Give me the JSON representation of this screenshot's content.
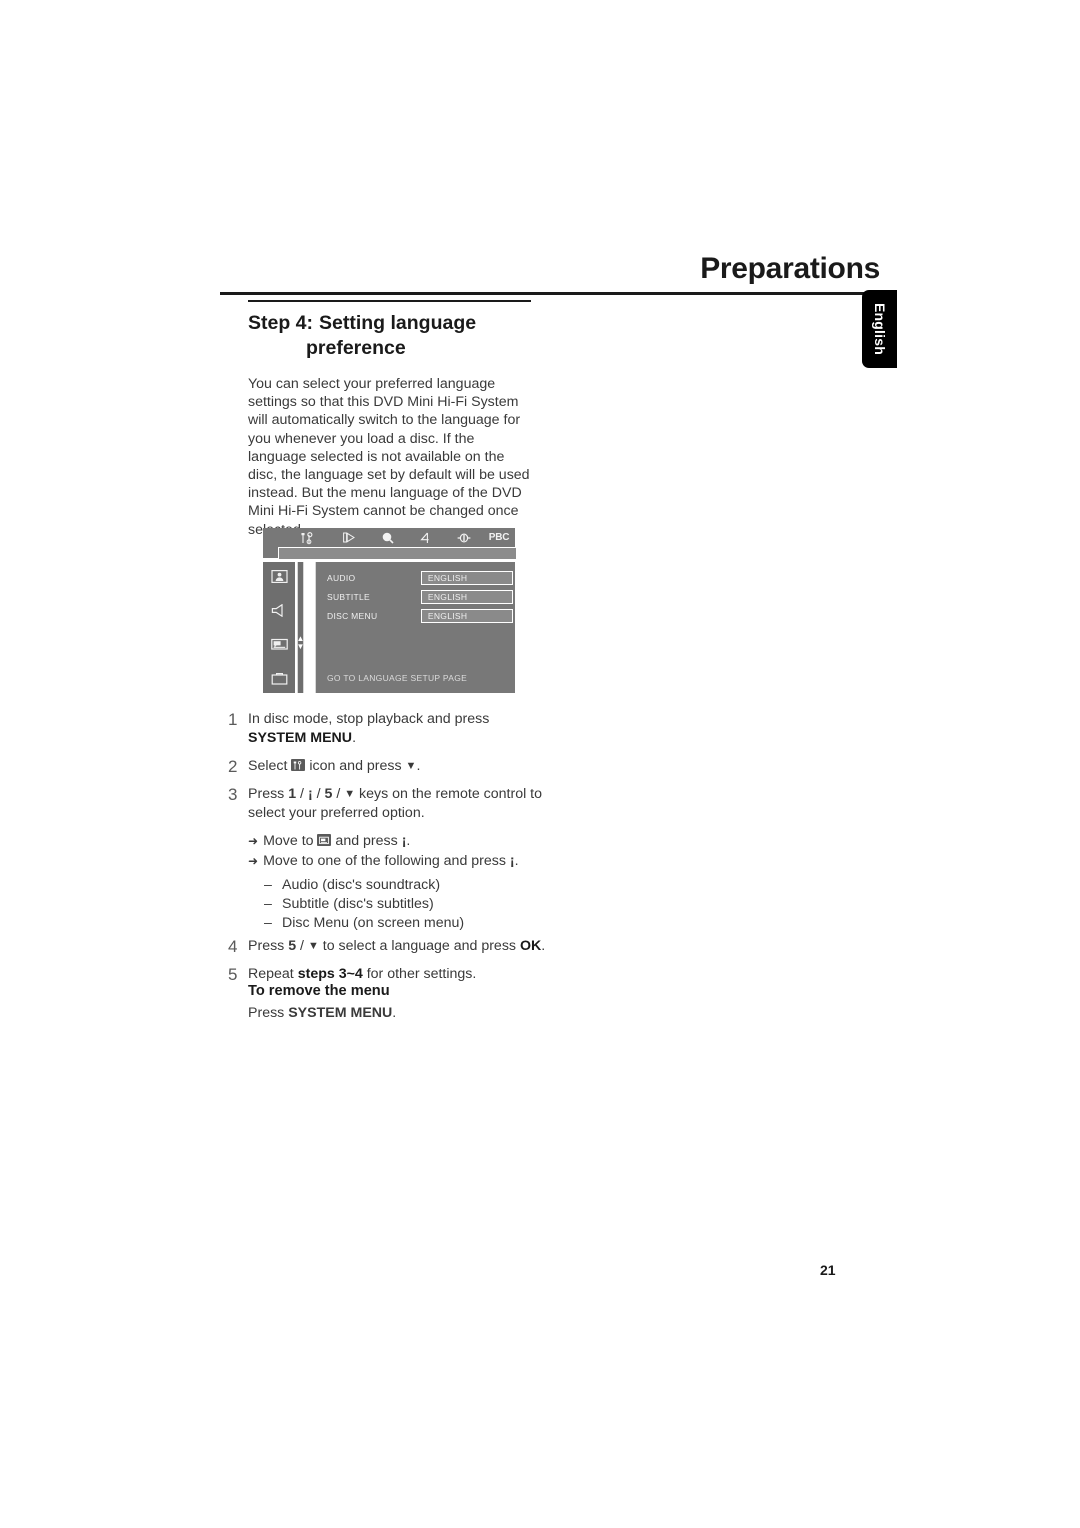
{
  "page": {
    "title": "Preparations",
    "number": "21",
    "language_tab": "English"
  },
  "section": {
    "step_label": "Step 4:",
    "title_line1": "Setting language",
    "title_line2": "preference",
    "intro": "You can select your preferred language settings so that this DVD Mini Hi-Fi System will automatically switch to the language for you whenever you load a disc. If the language selected is not available on the disc, the language set by default will be used instead. But the menu language of the DVD Mini Hi-Fi System cannot be changed once selected."
  },
  "osd": {
    "toolbar_icons": [
      {
        "name": "general-setup-icon",
        "glyph": "⚙"
      },
      {
        "name": "video-setup-icon",
        "glyph": "▷"
      },
      {
        "name": "zoom-icon",
        "glyph": "🔍"
      },
      {
        "name": "audio-setup-icon",
        "glyph": "4"
      },
      {
        "name": "sound-icon",
        "glyph": "◆"
      },
      {
        "name": "pbc-label",
        "glyph": "PBC"
      }
    ],
    "sidebar_icons": [
      {
        "name": "general-setup-page-icon"
      },
      {
        "name": "audio-setup-page-icon"
      },
      {
        "name": "language-setup-page-icon"
      },
      {
        "name": "preference-page-icon"
      }
    ],
    "rows": [
      {
        "label": "AUDIO",
        "value": "ENGLISH"
      },
      {
        "label": "SUBTITLE",
        "value": "ENGLISH"
      },
      {
        "label": "DISC MENU",
        "value": "ENGLISH"
      }
    ],
    "footer": "GO TO LANGUAGE SETUP PAGE"
  },
  "steps": [
    {
      "num": "1",
      "pre": "In disc mode, stop playback and press ",
      "bold": "SYSTEM MENU",
      "post": "."
    },
    {
      "num": "2",
      "pre": "Select ",
      "mid": " icon and press ",
      "glyph": "▼",
      "post": "."
    },
    {
      "num": "3",
      "pre": "Press ",
      "k1": "1",
      "sep1": " / ",
      "k2": "¡",
      "sep2": " / ",
      "k3": "5",
      "sep3": " / ",
      "k4": "▼",
      "post": " keys on the remote control to select your preferred option."
    },
    {
      "num": "4",
      "pre": "Press ",
      "k1": "5",
      "sep1": " / ",
      "k2": "▼",
      "mid": " to select a language and press ",
      "bold": "OK",
      "post": "."
    },
    {
      "num": "5",
      "pre": "Repeat ",
      "bold": "steps 3~4",
      "post": " for other settings."
    }
  ],
  "sub_items": {
    "arrow1_pre": "Move to ",
    "arrow1_mid": " and press ",
    "arrow1_key": "¡",
    "arrow1_post": ".",
    "arrow2_pre": "Move to one of the following and press ",
    "arrow2_key": "¡",
    "arrow2_post": ".",
    "dashes": [
      "Audio (disc's soundtrack)",
      "Subtitle (disc's subtitles)",
      "Disc Menu (on screen menu)"
    ]
  },
  "remove_menu": {
    "heading": "To remove the menu",
    "pre": "Press ",
    "bold": "SYSTEM MENU",
    "post": "."
  }
}
